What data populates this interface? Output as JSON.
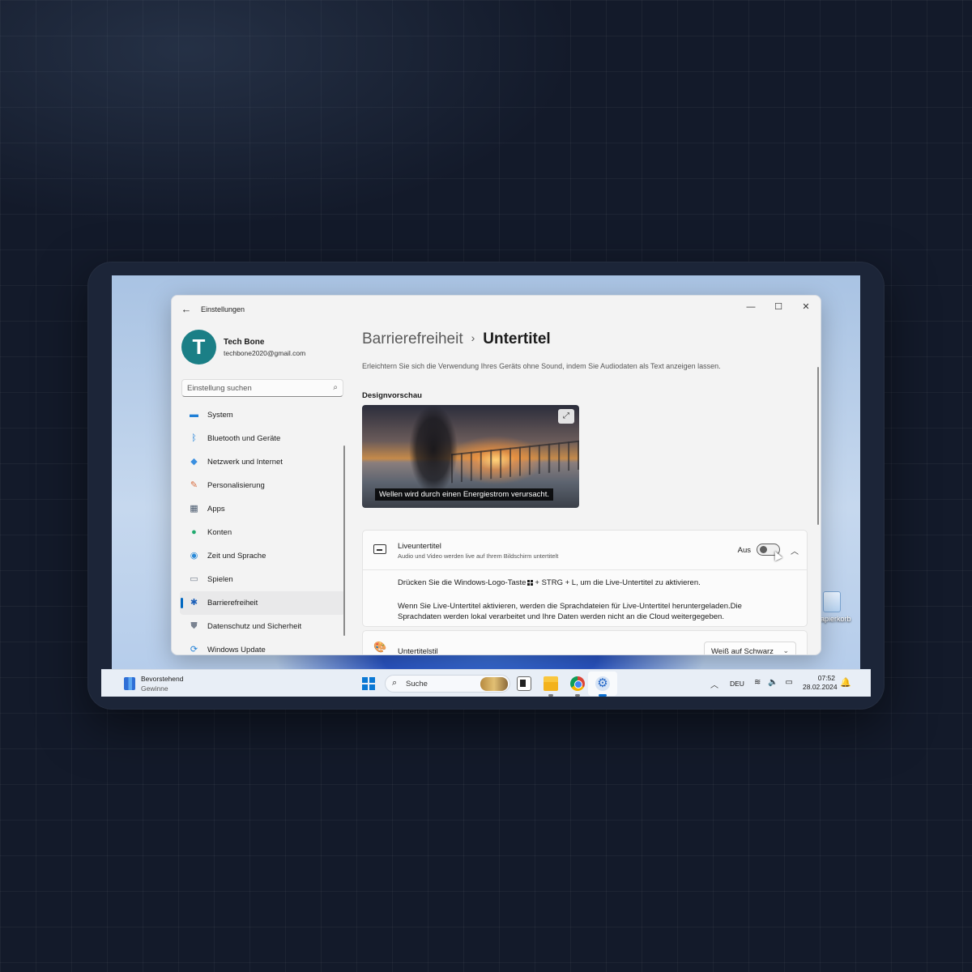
{
  "window": {
    "title": "Einstellungen",
    "back_glyph": "←",
    "min_glyph": "—",
    "max_glyph": "☐",
    "close_glyph": "✕"
  },
  "profile": {
    "initial": "T",
    "name": "Tech Bone",
    "email": "techbone2020@gmail.com"
  },
  "search": {
    "placeholder": "Einstellung suchen",
    "icon": "search-icon"
  },
  "nav": {
    "items": [
      {
        "label": "System",
        "icon": "monitor-icon",
        "glyph": "▬",
        "color": "#1f7fd6"
      },
      {
        "label": "Bluetooth und Geräte",
        "icon": "bluetooth-icon",
        "glyph": "ᛒ",
        "color": "#1f7fd6"
      },
      {
        "label": "Netzwerk und Internet",
        "icon": "wifi-icon",
        "glyph": "◆",
        "color": "#3a8fe0"
      },
      {
        "label": "Personalisierung",
        "icon": "brush-icon",
        "glyph": "✎",
        "color": "#d86b3d"
      },
      {
        "label": "Apps",
        "icon": "apps-icon",
        "glyph": "▦",
        "color": "#4a5a6e"
      },
      {
        "label": "Konten",
        "icon": "account-icon",
        "glyph": "●",
        "color": "#1faa6e"
      },
      {
        "label": "Zeit und Sprache",
        "icon": "globe-clock-icon",
        "glyph": "◉",
        "color": "#2a8ad8"
      },
      {
        "label": "Spielen",
        "icon": "gamepad-icon",
        "glyph": "▭",
        "color": "#7a8391"
      },
      {
        "label": "Barrierefreiheit",
        "icon": "accessibility-icon",
        "glyph": "✱",
        "color": "#1b5fb8"
      },
      {
        "label": "Datenschutz und Sicherheit",
        "icon": "shield-icon",
        "glyph": "⛊",
        "color": "#7a8391"
      },
      {
        "label": "Windows Update",
        "icon": "update-icon",
        "glyph": "⟳",
        "color": "#1f7fd6"
      }
    ],
    "active_index": 8
  },
  "content": {
    "breadcrumb_parent": "Barrierefreiheit",
    "breadcrumb_sep": "›",
    "breadcrumb_current": "Untertitel",
    "description": "Erleichtern Sie sich die Verwendung Ihres Geräts ohne Sound, indem Sie Audiodaten als Text anzeigen lassen.",
    "preview_heading": "Designvorschau",
    "preview_caption": "Wellen wird durch einen Energiestrom verursacht.",
    "expand_glyph": "⤢",
    "live": {
      "title": "Liveuntertitel",
      "subtitle": "Audio und Video werden live auf Ihrem Bildschirm untertitelt",
      "state": "Aus",
      "toggle_on": false,
      "chevron": "︿",
      "line1_before": "Drücken Sie die Windows-Logo-Taste",
      "line1_after": "+ STRG + L, um die Live-Untertitel zu aktivieren.",
      "line2": "Wenn Sie Live-Untertitel aktivieren, werden die Sprachdateien für Live-Untertitel heruntergeladen.Die Sprachdaten werden lokal verarbeitet und Ihre Daten werden nicht an die Cloud weitergegeben."
    },
    "style": {
      "title": "Untertitelstil",
      "palette_glyph": "🎨",
      "value": "Weiß auf Schwarz",
      "chevron": "⌄"
    }
  },
  "desktop": {
    "icon_label": "Papierkorb"
  },
  "taskbar": {
    "widget_title": "Bevorstehend",
    "widget_subtitle": "Gewinne",
    "search_label": "Suche",
    "search_glyph": "⌕",
    "tray_chevron": "︿",
    "language": "DEU",
    "tray_glyphs": "≋ 🔈 ▭",
    "time": "07:52",
    "date": "28.02.2024",
    "bell_glyph": "🔔"
  }
}
